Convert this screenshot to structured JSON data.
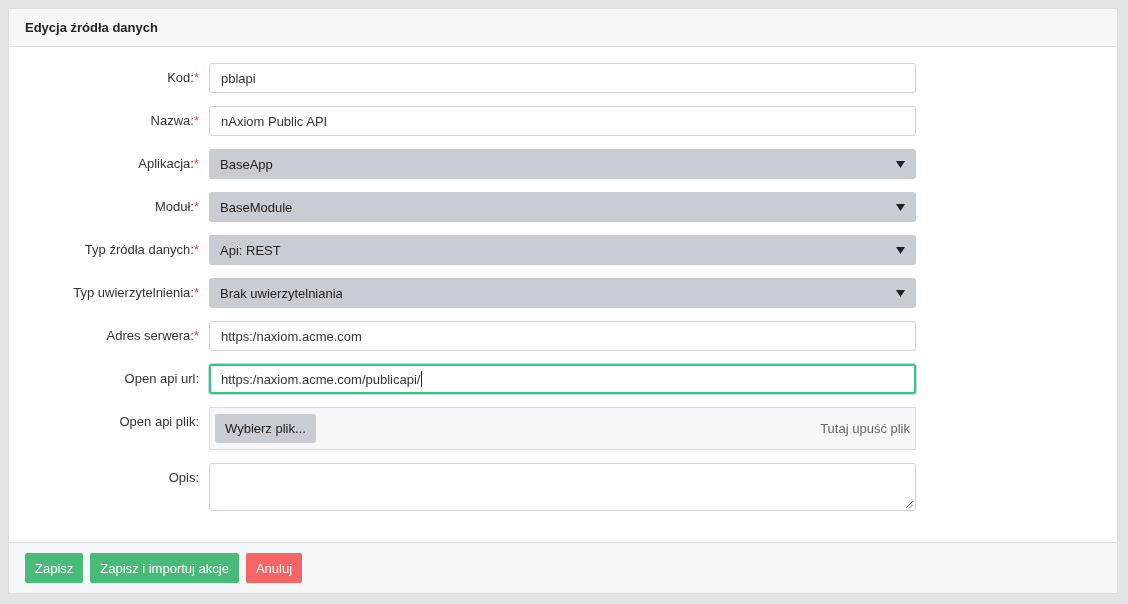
{
  "panel": {
    "title": "Edycja źródła danych"
  },
  "fields": [
    {
      "kind": "text",
      "label": "Kod:",
      "required_mark": "*",
      "value": "pblapi",
      "focused": false
    },
    {
      "kind": "text",
      "label": "Nazwa:",
      "required_mark": "*",
      "value": "nAxiom Public API",
      "focused": false
    },
    {
      "kind": "select",
      "label": "Aplikacja:",
      "required_mark": "*",
      "value": "BaseApp"
    },
    {
      "kind": "select",
      "label": "Moduł:",
      "required_mark": "*",
      "value": "BaseModule"
    },
    {
      "kind": "select",
      "label": "Typ źródła danych:",
      "required_mark": "*",
      "value": "Api: REST"
    },
    {
      "kind": "select",
      "label": "Typ uwierzytelnienia:",
      "required_mark": "*",
      "value": "Brak uwierzytelniania"
    },
    {
      "kind": "text",
      "label": "Adres serwera:",
      "required_mark": "*",
      "value": "https:/naxiom.acme.com",
      "focused": false
    },
    {
      "kind": "text",
      "label": "Open api url:",
      "value": "https:/naxiom.acme.com/publicapi/",
      "focused": true
    },
    {
      "kind": "file",
      "label": "Open api plik:",
      "button": "Wybierz plik...",
      "hint": "Tutaj upuść plik"
    },
    {
      "kind": "textarea",
      "label": "Opis:"
    }
  ],
  "buttons": [
    {
      "label": "Zapisz",
      "kind": "success"
    },
    {
      "label": "Zapisz i importuj akcje",
      "kind": "success"
    },
    {
      "label": "Anuluj",
      "kind": "danger"
    }
  ]
}
